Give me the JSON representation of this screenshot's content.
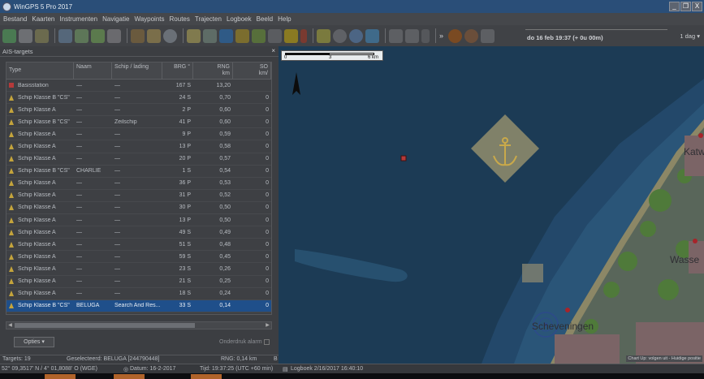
{
  "window": {
    "title": "WinGPS 5 Pro 2017",
    "buttons": [
      "_",
      "❐",
      "X"
    ]
  },
  "menu": [
    "Bestand",
    "Kaarten",
    "Instrumenten",
    "Navigatie",
    "Waypoints",
    "Routes",
    "Trajecten",
    "Logboek",
    "Beeld",
    "Help"
  ],
  "toolbar": {
    "datetime": "do 16 feb 19:37  (+ 0u 00m)",
    "day_range": "1 dag",
    "more": "»"
  },
  "ais": {
    "title": "AIS-targets",
    "close": "×",
    "columns": {
      "type": "Type",
      "name": "Naam",
      "ship": "Schip / lading",
      "brg": "BRG",
      "brg_unit": "°",
      "rng": "RNG",
      "rng_unit": "km",
      "so": "SO",
      "so_unit": "km/"
    },
    "rows": [
      {
        "icon": "station",
        "type": "Basisstation",
        "name": "—",
        "ship": "—",
        "brg": "167 S",
        "rng": "13,20",
        "so": ""
      },
      {
        "icon": "ship",
        "type": "Schip Klasse B \"CS\"",
        "name": "—",
        "ship": "—",
        "brg": "24 S",
        "rng": "0,70",
        "so": "0"
      },
      {
        "icon": "ship",
        "type": "Schip Klasse A",
        "name": "—",
        "ship": "—",
        "brg": "2 P",
        "rng": "0,60",
        "so": "0"
      },
      {
        "icon": "ship",
        "type": "Schip Klasse B \"CS\"",
        "name": "—",
        "ship": "Zeilschip",
        "brg": "41 P",
        "rng": "0,60",
        "so": "0"
      },
      {
        "icon": "ship",
        "type": "Schip Klasse A",
        "name": "—",
        "ship": "—",
        "brg": "9 P",
        "rng": "0,59",
        "so": "0"
      },
      {
        "icon": "ship",
        "type": "Schip Klasse A",
        "name": "—",
        "ship": "—",
        "brg": "13 P",
        "rng": "0,58",
        "so": "0"
      },
      {
        "icon": "ship",
        "type": "Schip Klasse A",
        "name": "—",
        "ship": "—",
        "brg": "20 P",
        "rng": "0,57",
        "so": "0"
      },
      {
        "icon": "ship",
        "type": "Schip Klasse B \"CS\"",
        "name": "CHARLIE",
        "ship": "—",
        "brg": "1 S",
        "rng": "0,54",
        "so": "0"
      },
      {
        "icon": "ship",
        "type": "Schip Klasse A",
        "name": "—",
        "ship": "—",
        "brg": "36 P",
        "rng": "0,53",
        "so": "0"
      },
      {
        "icon": "ship",
        "type": "Schip Klasse A",
        "name": "—",
        "ship": "—",
        "brg": "31 P",
        "rng": "0,52",
        "so": "0"
      },
      {
        "icon": "ship",
        "type": "Schip Klasse A",
        "name": "—",
        "ship": "—",
        "brg": "30 P",
        "rng": "0,50",
        "so": "0"
      },
      {
        "icon": "ship",
        "type": "Schip Klasse A",
        "name": "—",
        "ship": "—",
        "brg": "13 P",
        "rng": "0,50",
        "so": "0"
      },
      {
        "icon": "ship",
        "type": "Schip Klasse A",
        "name": "—",
        "ship": "—",
        "brg": "49 S",
        "rng": "0,49",
        "so": "0"
      },
      {
        "icon": "ship",
        "type": "Schip Klasse A",
        "name": "—",
        "ship": "—",
        "brg": "51 S",
        "rng": "0,48",
        "so": "0"
      },
      {
        "icon": "ship",
        "type": "Schip Klasse A",
        "name": "—",
        "ship": "—",
        "brg": "59 S",
        "rng": "0,45",
        "so": "0"
      },
      {
        "icon": "ship",
        "type": "Schip Klasse A",
        "name": "—",
        "ship": "—",
        "brg": "23 S",
        "rng": "0,26",
        "so": "0"
      },
      {
        "icon": "ship",
        "type": "Schip Klasse A",
        "name": "—",
        "ship": "—",
        "brg": "21 S",
        "rng": "0,25",
        "so": "0"
      },
      {
        "icon": "ship",
        "type": "Schip Klasse A",
        "name": "—",
        "ship": "—",
        "brg": "18 S",
        "rng": "0,24",
        "so": "0"
      },
      {
        "icon": "ship",
        "type": "Schip Klasse B \"CS\"",
        "name": "BELUGA",
        "ship": "Search And Res...",
        "brg": "33 S",
        "rng": "0,14",
        "so": "0",
        "selected": true
      }
    ],
    "options_label": "Opties",
    "alarm_label": "Onderdruk alarm"
  },
  "panel_status": {
    "targets": "Targets: 19",
    "selected": "Geselecteerd: BELUGA [244790448]",
    "rng": "RNG: 0,14 km",
    "extra": "B"
  },
  "map": {
    "scale": {
      "start": "0",
      "mid": "3",
      "end": "6 km"
    },
    "towns": {
      "katwijk": "Katw",
      "wassenaar": "Wasse",
      "scheveningen": "Scheveningen"
    },
    "note": "Chart Up: volgen uit - Huidige positie"
  },
  "statusbar": {
    "position": "52° 09,3517' N / 4° 01,8088' O (WGE)",
    "datum": "Datum: 16-2-2017",
    "time": "Tijd: 19:37:25 (UTC +60 min)",
    "log": "Logboek 2/16/2017 16:40:10"
  },
  "colors": {
    "accent": "#1f4f8a",
    "sea": "#1d3d56",
    "land": "#59665a"
  }
}
